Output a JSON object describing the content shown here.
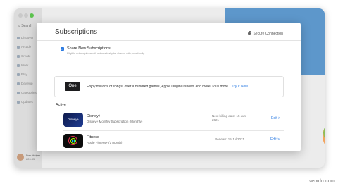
{
  "sidebar": {
    "search_label": "Search",
    "items": [
      {
        "label": "Discover"
      },
      {
        "label": "Arcade"
      },
      {
        "label": "Create"
      },
      {
        "label": "Work"
      },
      {
        "label": "Play"
      },
      {
        "label": "Develop"
      },
      {
        "label": "Categories"
      },
      {
        "label": "Updates"
      }
    ],
    "user": {
      "name": "Dan Helyer",
      "balance": "£26.85"
    }
  },
  "sheet": {
    "title": "Subscriptions",
    "secure_label": "Secure Connection",
    "share": {
      "checked": true,
      "label": "Share New Subscriptions",
      "description": "Eligible subscriptions will automatically be shared with your family."
    },
    "promo": {
      "logo_text": "One",
      "text": "Enjoy millions of songs, over a hundred games, Apple Original shows and more. Plus more.",
      "link": "Try It Now"
    },
    "active_label": "Active",
    "subscriptions": [
      {
        "name": "Disney+",
        "plan": "Disney+ Monthly Subscription (Monthly)",
        "status_line1": "Next billing date: 15 Jun",
        "status_line2": "2021",
        "edit": "Edit >",
        "icon": "disney-plus-icon",
        "icon_text": "Disney+"
      },
      {
        "name": "Fitness",
        "plan": "Apple Fitness+ (1 month)",
        "status_line1": "Renews: 15 Jul 2021",
        "status_line2": "",
        "edit": "Edit >",
        "icon": "fitness-rings-icon"
      }
    ]
  },
  "watermark": "wsxdn.com",
  "colors": {
    "accent": "#2a7ae2",
    "banner": "#5d97cb",
    "fitness_rings": [
      "#e8344e",
      "#a6ff00",
      "#00d1ff"
    ]
  }
}
